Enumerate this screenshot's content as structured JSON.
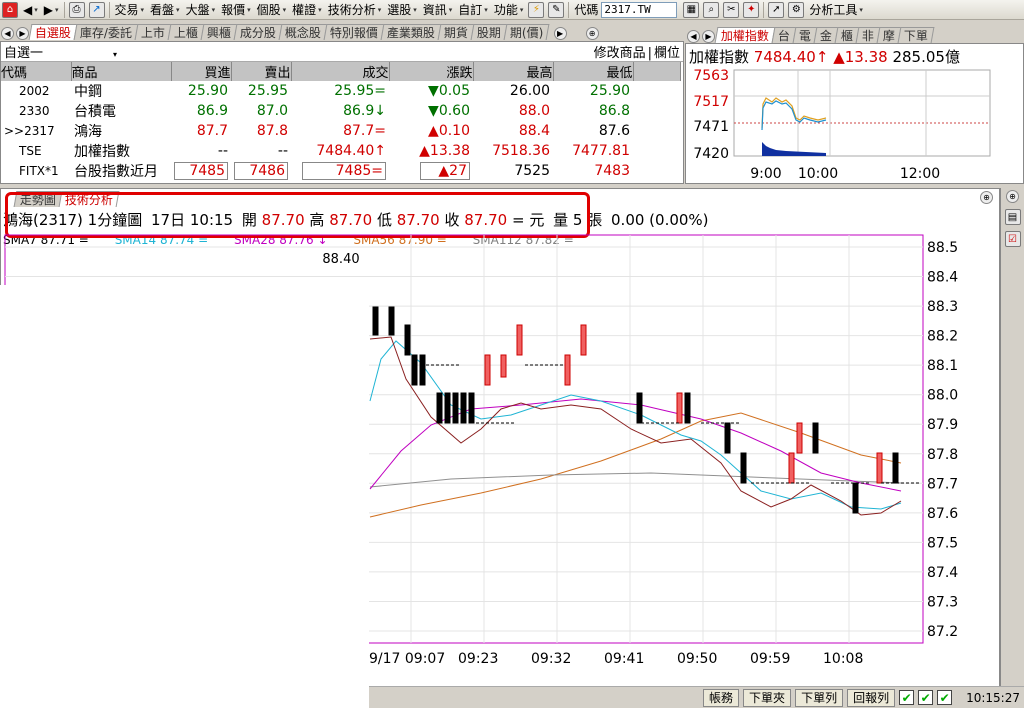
{
  "menu": {
    "items": [
      "交易",
      "看盤",
      "大盤",
      "報價",
      "個股",
      "權證",
      "技術分析",
      "選股",
      "資訊",
      "自訂",
      "功能"
    ],
    "code_label": "代碼",
    "code_value": "2317.TW",
    "analysis_tool": "分析工具"
  },
  "quote_tabs": [
    "自選股",
    "庫存/委託",
    "上市",
    "上櫃",
    "興櫃",
    "成分股",
    "概念股",
    "特別報價",
    "產業類股",
    "期貨",
    "股期",
    "期(價)"
  ],
  "quote_tab_active": 0,
  "watchlist": {
    "name": "自選一",
    "edit_label": "修改商品",
    "field_label": "欄位",
    "columns": [
      "代碼",
      "商品",
      "買進",
      "賣出",
      "成交",
      "漲跌",
      "最高",
      "最低"
    ],
    "rows": [
      {
        "code": "2002",
        "name": "中鋼",
        "bid": "25.90",
        "ask": "25.95",
        "last": "25.95=",
        "chg": "▼0.05",
        "high": "26.00",
        "low": "25.90",
        "dir": "down"
      },
      {
        "code": "2330",
        "name": "台積電",
        "bid": "86.9",
        "ask": "87.0",
        "last": "86.9↓",
        "chg": "▼0.60",
        "high": "88.0",
        "low": "86.8",
        "dir": "down"
      },
      {
        "code": ">>2317",
        "name": "鴻海",
        "bid": "87.7",
        "ask": "87.8",
        "last": "87.7=",
        "chg": "▲0.10",
        "high": "88.4",
        "low": "87.6",
        "dir": "up"
      },
      {
        "code": "TSE",
        "name": "加權指數",
        "bid": "--",
        "ask": "--",
        "last": "7484.40↑",
        "chg": "▲13.38",
        "high": "7518.36",
        "low": "7477.81",
        "dir": "up"
      },
      {
        "code": "FITX*1",
        "name": "台股指數近月",
        "bid": "7485",
        "ask": "7486",
        "last": "7485=",
        "chg": "▲27",
        "high": "7525",
        "low": "7483",
        "dir": "up"
      }
    ]
  },
  "index_tabs": [
    "加權指數",
    "台",
    "電",
    "金",
    "櫃",
    "非",
    "摩",
    "下單"
  ],
  "index": {
    "name": "加權指數",
    "value": "7484.40↑",
    "change": "▲13.38",
    "volume": "285.05億",
    "y_labels": [
      "7563",
      "7517",
      "7471",
      "7420"
    ],
    "x_labels": [
      "9:00",
      "10:00",
      "12:00"
    ]
  },
  "chart_tabs": [
    "走勢圖",
    "技術分析"
  ],
  "chart_info": {
    "title": "鴻海(2317)",
    "period": "1分鐘圖",
    "datetime": "17日 10:15",
    "open_label": "開",
    "open": "87.70",
    "high_label": "高",
    "high": "87.70",
    "low_label": "低",
    "low": "87.70",
    "close_label": "收",
    "close": "87.70",
    "unit": "= 元",
    "vol_label": "量",
    "vol": "5 張",
    "change": "0.00 (0.00%)"
  },
  "ma": [
    {
      "label": "SMA7 87.71 =",
      "color": "#000000"
    },
    {
      "label": "SMA14 87.74 =",
      "color": "#1fb4d4"
    },
    {
      "label": "SMA28 87.76 ↓",
      "color": "#c000c0"
    },
    {
      "label": "SMA56 87.90 =",
      "color": "#d07020"
    },
    {
      "label": "SMA112 87.82 =",
      "color": "#808080"
    }
  ],
  "chart_peak_label": "88.40",
  "chart_data": {
    "type": "candlestick",
    "y_ticks": [
      "88.5",
      "88.4",
      "88.3",
      "88.2",
      "88.1",
      "88.0",
      "87.9",
      "87.8",
      "87.7",
      "87.6",
      "87.5",
      "87.4",
      "87.3",
      "87.2"
    ],
    "ylim": [
      87.2,
      88.5
    ],
    "x_ticks": [
      "9/17 09:07",
      "09:23",
      "09:32",
      "09:41",
      "09:50",
      "09:59",
      "10:08"
    ]
  },
  "status": {
    "buttons": [
      "帳務",
      "下單夾",
      "下單列",
      "回報列"
    ],
    "time": "10:15:27"
  }
}
